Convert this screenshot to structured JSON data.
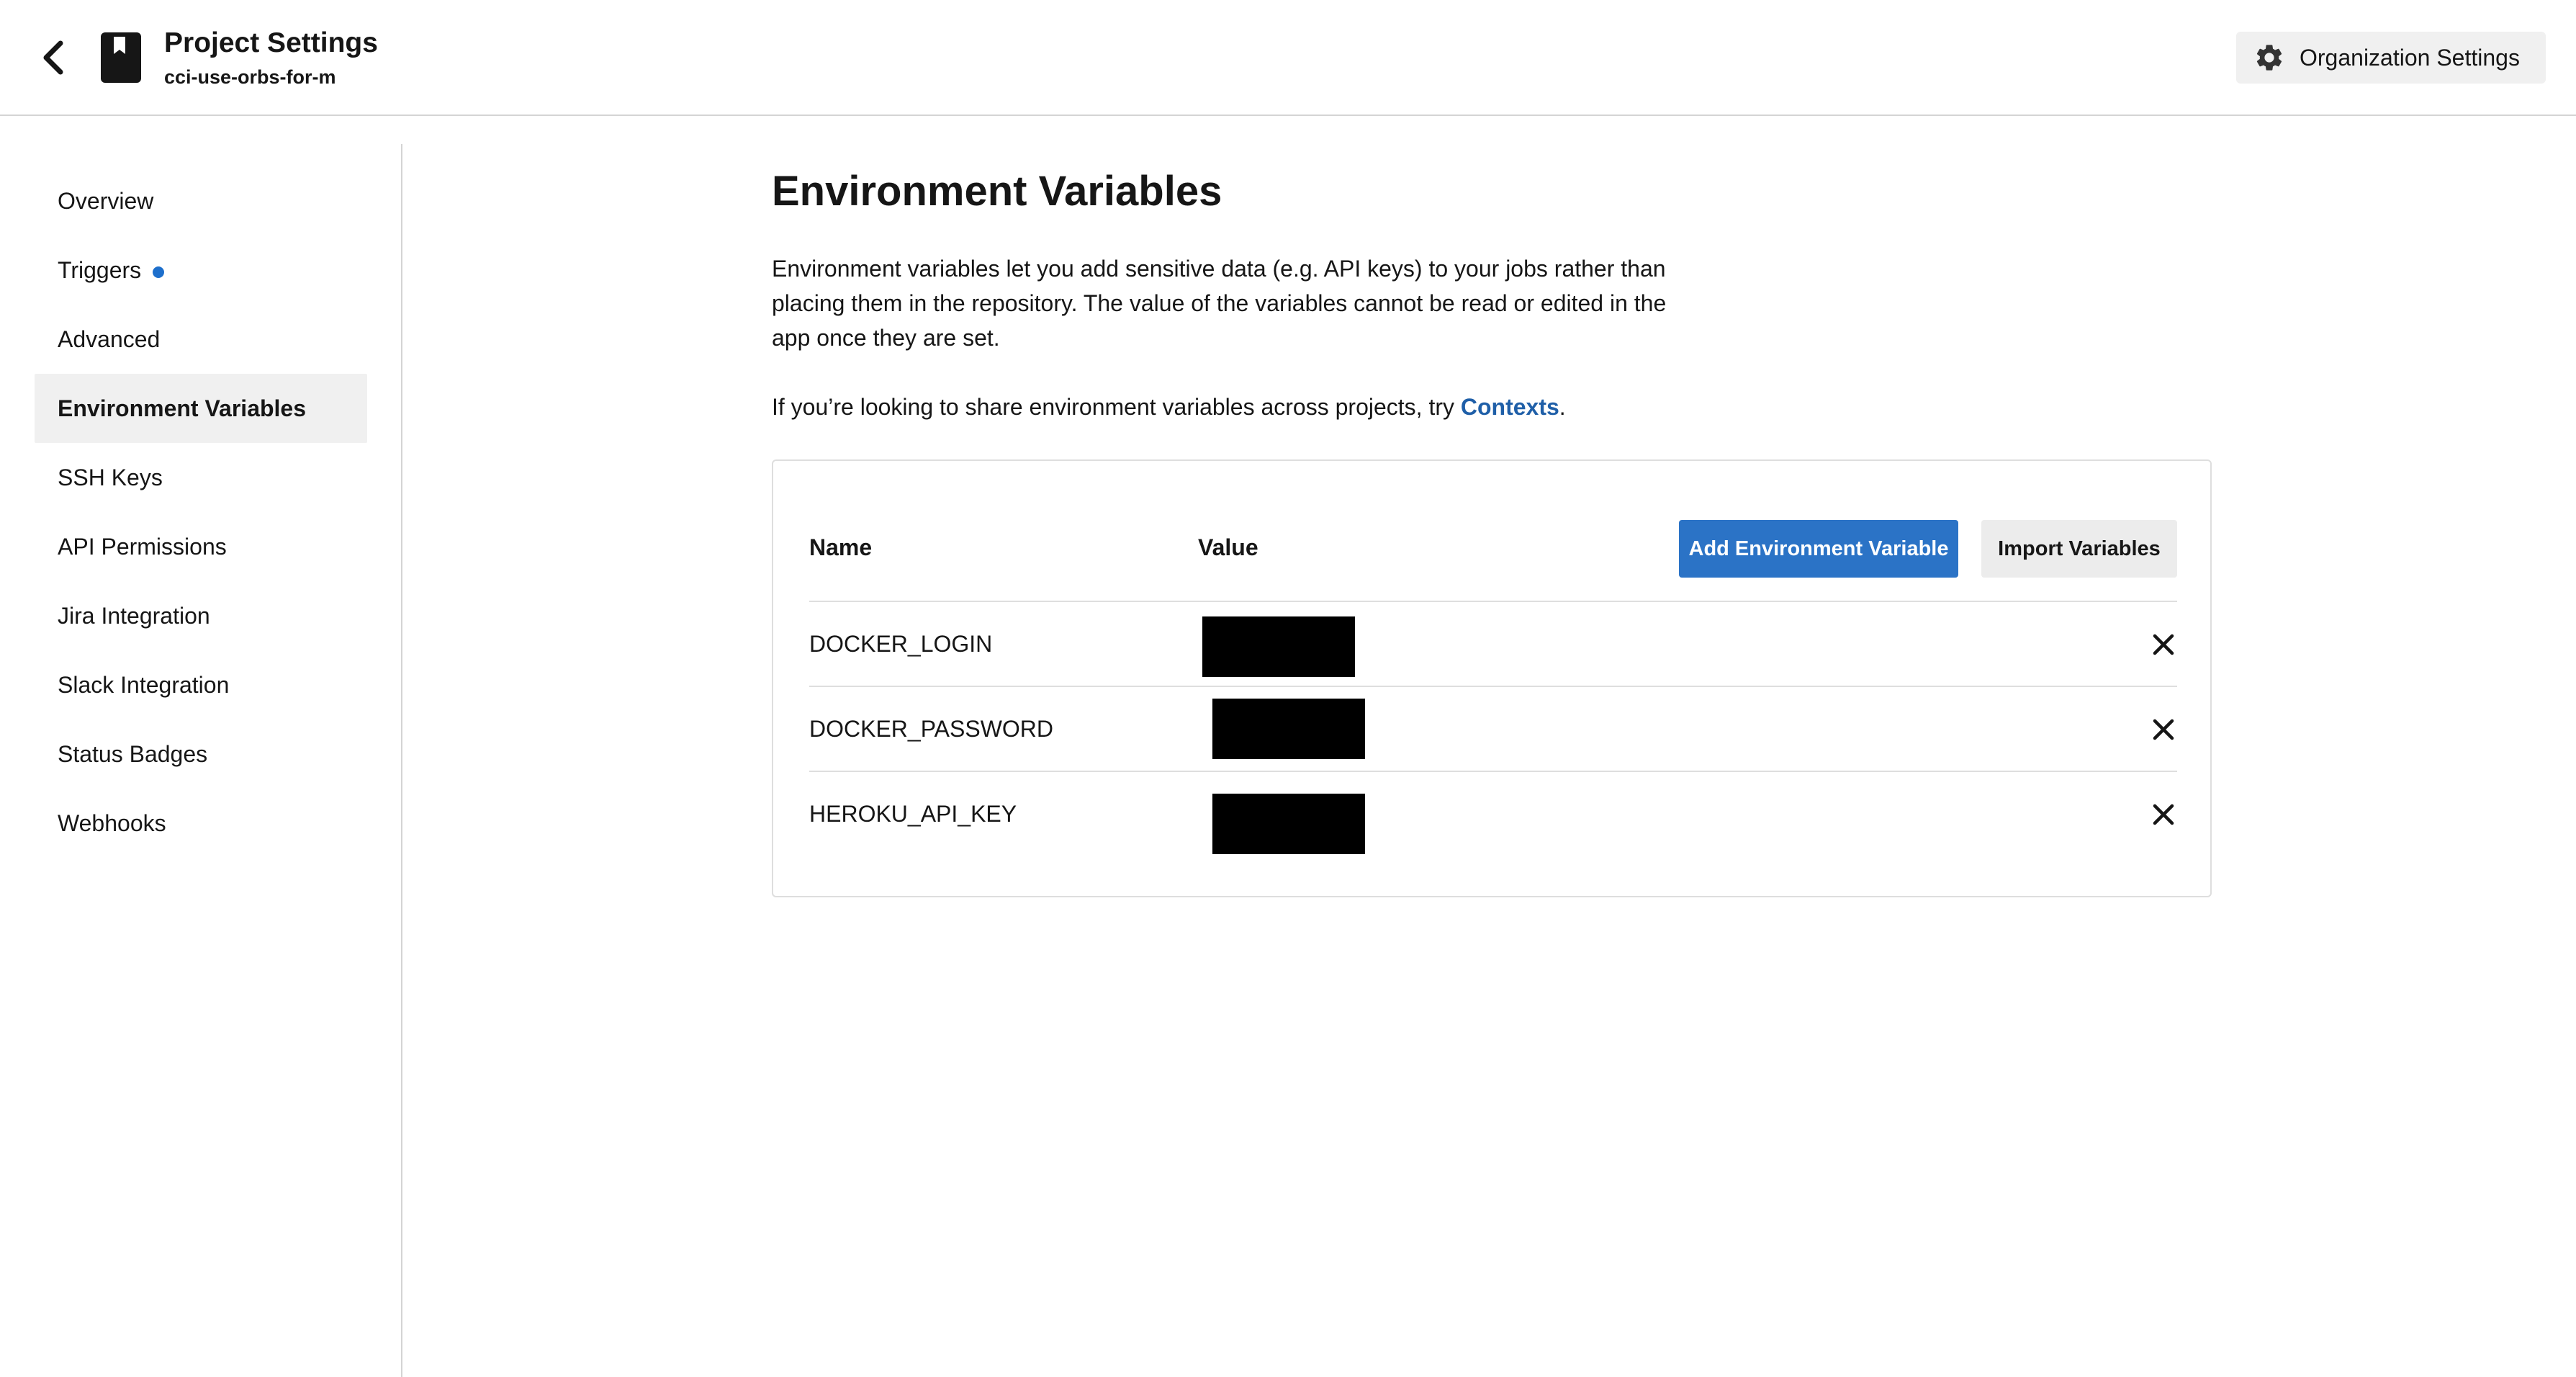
{
  "header": {
    "title": "Project Settings",
    "subtitle": "cci-use-orbs-for-m",
    "org_settings_label": "Organization Settings"
  },
  "sidebar": {
    "items": [
      {
        "label": "Overview"
      },
      {
        "label": "Triggers",
        "indicator": "blue-dot"
      },
      {
        "label": "Advanced"
      },
      {
        "label": "Environment Variables",
        "active": true
      },
      {
        "label": "SSH Keys"
      },
      {
        "label": "API Permissions"
      },
      {
        "label": "Jira Integration"
      },
      {
        "label": "Slack Integration"
      },
      {
        "label": "Status Badges"
      },
      {
        "label": "Webhooks"
      }
    ]
  },
  "main": {
    "title": "Environment Variables",
    "description": "Environment variables let you add sensitive data (e.g. API keys) to your jobs rather than placing them in the repository. The value of the variables cannot be read or edited in the app once they are set.",
    "contexts_prefix": "If you’re looking to share environment variables across projects, try ",
    "contexts_link": "Contexts",
    "contexts_suffix": "."
  },
  "table": {
    "headers": {
      "name": "Name",
      "value": "Value"
    },
    "add_button": "Add Environment Variable",
    "import_button": "Import Variables",
    "rows": [
      {
        "name": "DOCKER_LOGIN"
      },
      {
        "name": "DOCKER_PASSWORD"
      },
      {
        "name": "HEROKU_API_KEY"
      }
    ]
  },
  "colors": {
    "accent": "#2b73c6",
    "link": "#1f5fa8",
    "indicator": "#1d6fcc",
    "active_bg": "#f0f0f0"
  },
  "icons": {
    "back": "chevron-left-icon",
    "project": "bookmark-icon",
    "org_settings": "gear-icon",
    "delete": "close-icon"
  }
}
